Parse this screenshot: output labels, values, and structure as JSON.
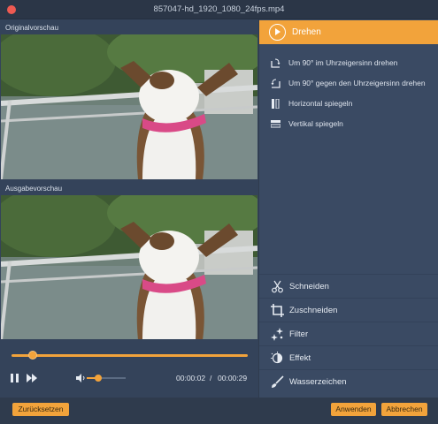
{
  "window": {
    "title": "857047-hd_1920_1080_24fps.mp4"
  },
  "preview": {
    "original_label": "Originalvorschau",
    "output_label": "Ausgabevorschau"
  },
  "player": {
    "progress": 0.09,
    "volume": 0.3,
    "current_time": "00:00:02",
    "separator": "/",
    "total_time": "00:00:29"
  },
  "sidebar": {
    "rotate_header": "Drehen",
    "rotate_options": [
      {
        "label": "Um 90° im Uhrzeigersinn drehen",
        "icon": "rotate-clockwise-icon"
      },
      {
        "label": "Um 90° gegen den Uhrzeigersinn drehen",
        "icon": "rotate-counterclockwise-icon"
      },
      {
        "label": "Horizontal spiegeln",
        "icon": "flip-horizontal-icon"
      },
      {
        "label": "Vertikal spiegeln",
        "icon": "flip-vertical-icon"
      }
    ],
    "tools": [
      {
        "label": "Schneiden",
        "icon": "scissors-icon"
      },
      {
        "label": "Zuschneiden",
        "icon": "crop-icon"
      },
      {
        "label": "Filter",
        "icon": "filter-sparkle-icon"
      },
      {
        "label": "Effekt",
        "icon": "effect-icon"
      },
      {
        "label": "Wasserzeichen",
        "icon": "watermark-brush-icon"
      }
    ]
  },
  "buttons": {
    "reset": "Zurücksetzen",
    "apply": "Anwenden",
    "cancel": "Abbrechen"
  },
  "colors": {
    "accent": "#f2a33b",
    "close": "#ee5a52",
    "panel": "#3a4a63",
    "background": "#2f3b4d"
  }
}
